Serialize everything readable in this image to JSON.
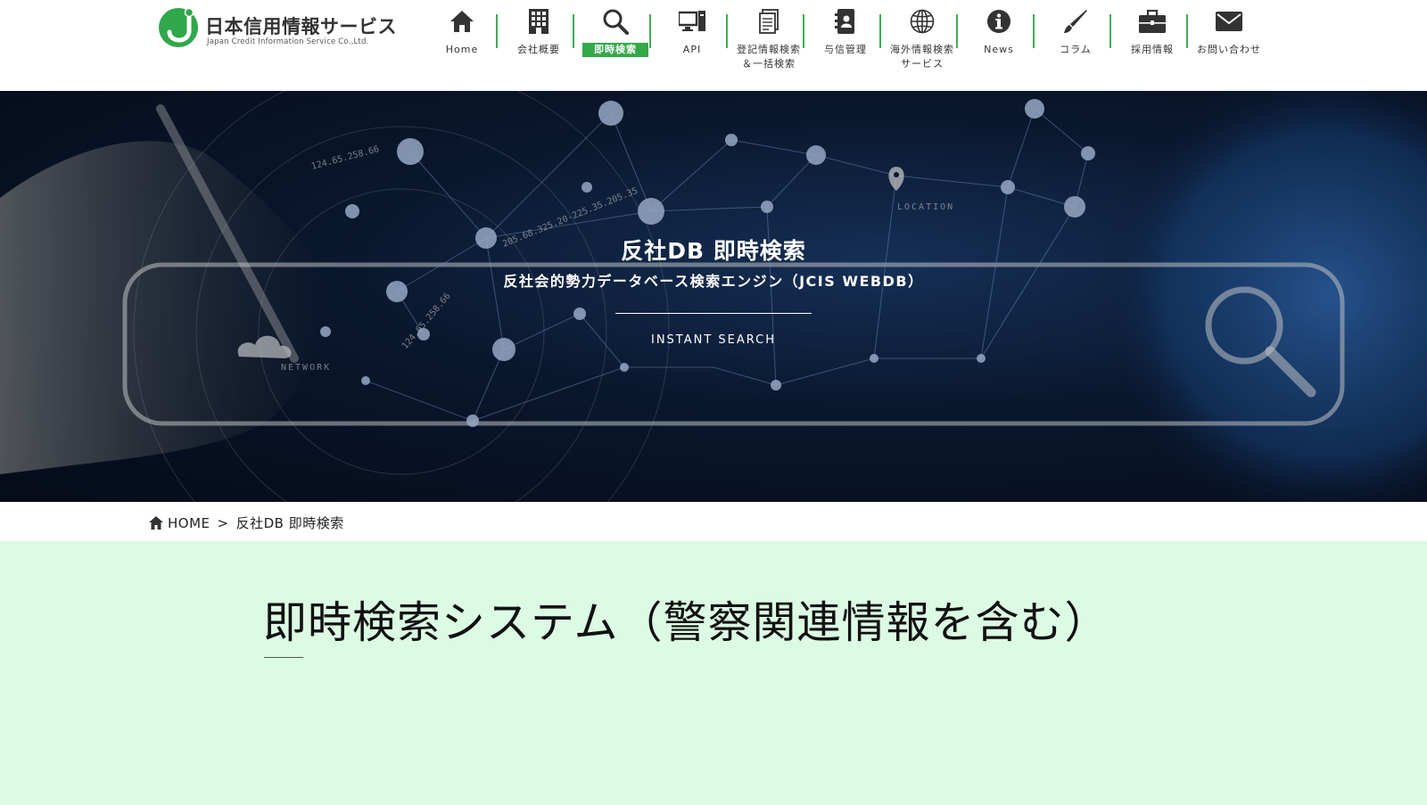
{
  "logo": {
    "title": "日本信用情報サービス",
    "subtitle": "Japan Credit Information Service Co.,Ltd."
  },
  "nav": {
    "items": [
      {
        "label": "Home",
        "icon": "home-icon"
      },
      {
        "label": "会社概要",
        "icon": "building-icon"
      },
      {
        "label": "即時検索",
        "icon": "search-icon",
        "active": true
      },
      {
        "label": "API",
        "icon": "computer-icon"
      },
      {
        "label": "登記情報検索\n＆一括検索",
        "icon": "document-icon"
      },
      {
        "label": "与信管理",
        "icon": "contact-book-icon"
      },
      {
        "label": "海外情報検索\nサービス",
        "icon": "globe-icon"
      },
      {
        "label": "News",
        "icon": "info-icon"
      },
      {
        "label": "コラム",
        "icon": "pen-icon"
      },
      {
        "label": "採用情報",
        "icon": "briefcase-icon"
      },
      {
        "label": "お問い合わせ",
        "icon": "mail-icon"
      }
    ]
  },
  "hero": {
    "title": "反社DB 即時検索",
    "subtitle": "反社会的勢力データベース検索エンジン（JCIS WEBDB）",
    "subtitle_en": "INSTANT SEARCH",
    "image_texts": [
      "LOCATION",
      "NETWORK",
      "124.65.258.66",
      "205.68.325.20-225.35.205.35",
      "124.65.258.66"
    ]
  },
  "breadcrumb": {
    "home": "HOME",
    "separator": ">",
    "current": "反社DB 即時検索"
  },
  "main": {
    "title": "即時検索システム（警察関連情報を含む）"
  },
  "colors": {
    "accent_green": "#33a94a",
    "main_background": "#dcfbe4",
    "hero_dark": "#0d1c35"
  }
}
